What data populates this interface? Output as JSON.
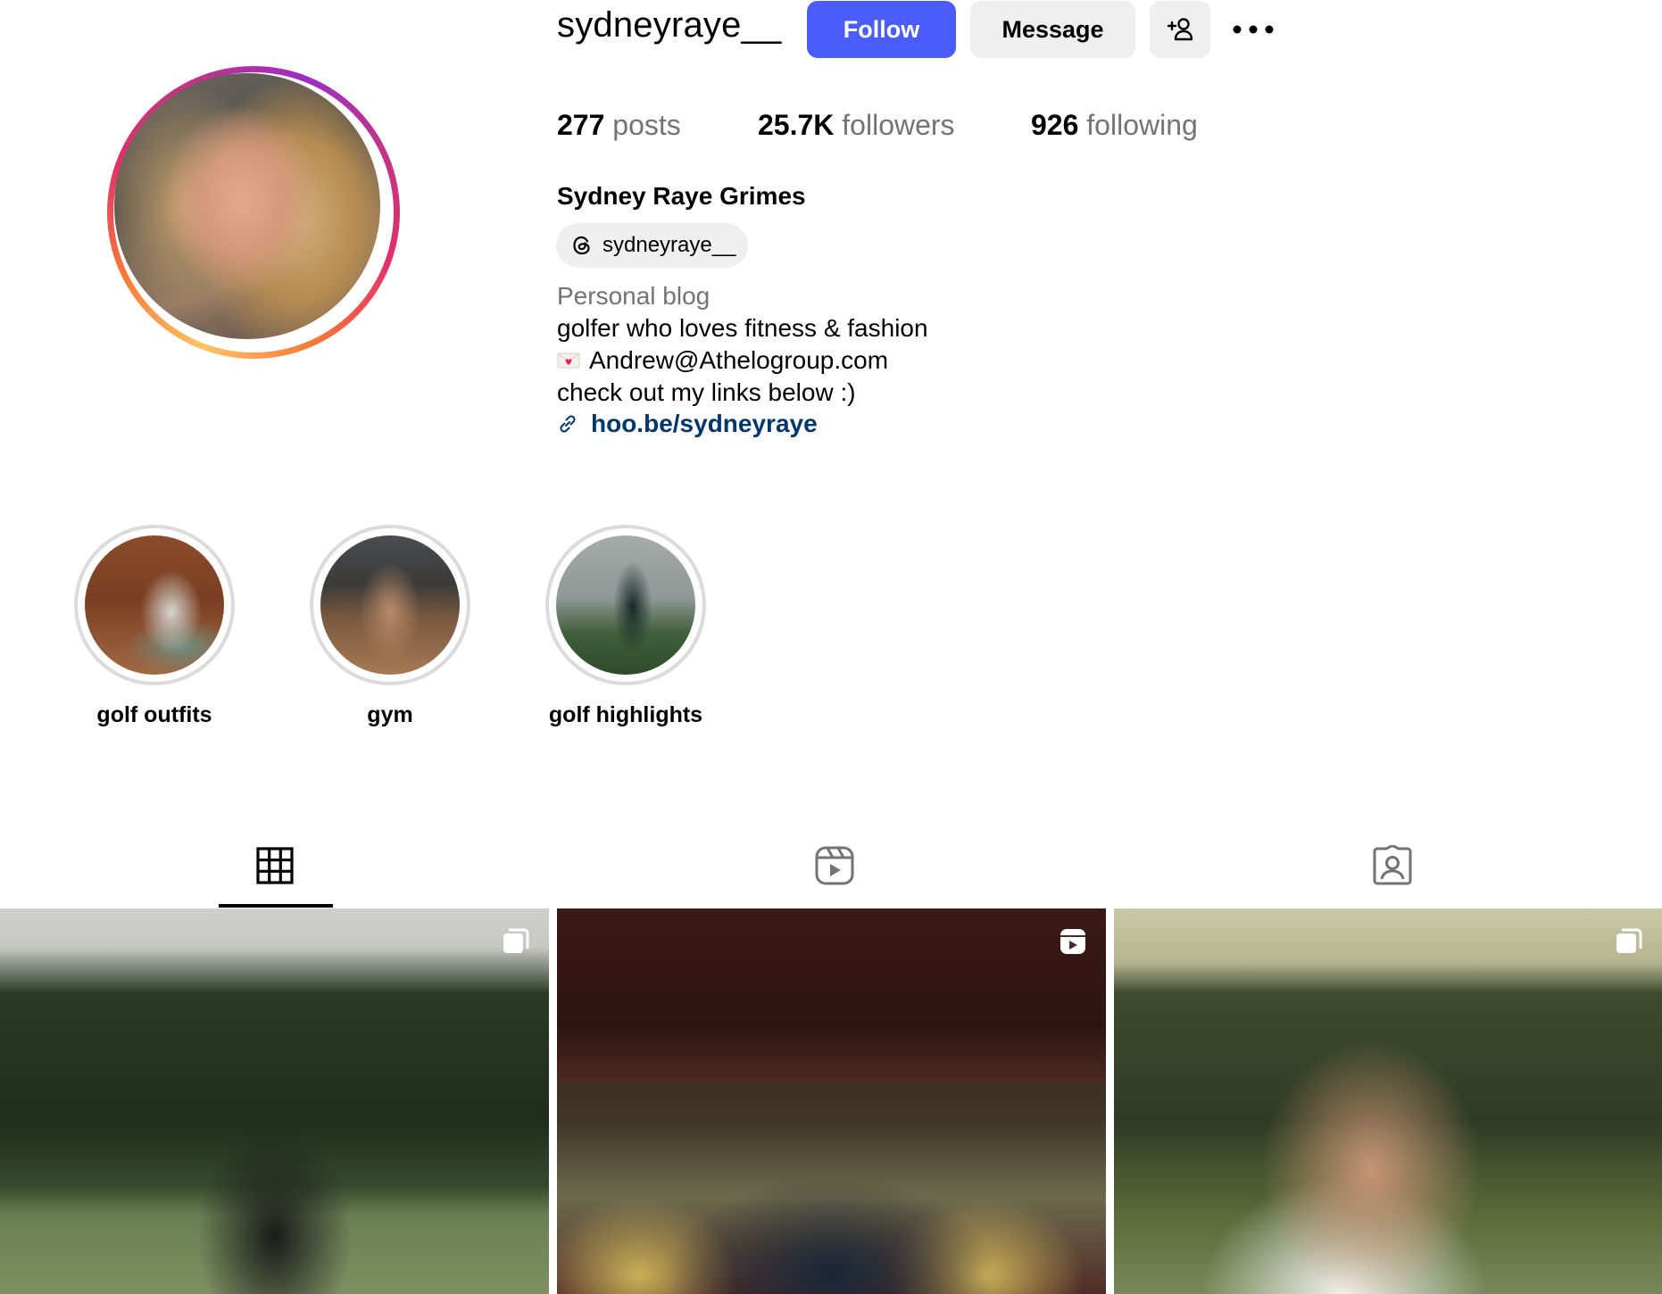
{
  "profile": {
    "username": "sydneyraye__",
    "full_name": "Sydney Raye Grimes",
    "threads_handle": "sydneyraye__",
    "category": "Personal blog",
    "bio": [
      "golfer who loves fitness & fashion",
      "Andrew@Athelogroup.com",
      "check out my links below :)"
    ],
    "link": "hoo.be/sydneyraye"
  },
  "buttons": {
    "follow": "Follow",
    "message": "Message"
  },
  "stats": {
    "posts": {
      "count": "277",
      "label": "posts"
    },
    "followers": {
      "count": "25.7K",
      "label": "followers"
    },
    "following": {
      "count": "926",
      "label": "following"
    }
  },
  "highlights": [
    {
      "label": "golf outfits"
    },
    {
      "label": "gym"
    },
    {
      "label": "golf highlights"
    }
  ],
  "tabs": [
    {
      "icon": "grid-icon",
      "active": true
    },
    {
      "icon": "reels-icon",
      "active": false
    },
    {
      "icon": "tagged-icon",
      "active": false
    }
  ],
  "grid_posts": [
    {
      "type": "carousel",
      "icon": "carousel-icon"
    },
    {
      "type": "reel",
      "icon": "reel-icon"
    },
    {
      "type": "carousel",
      "icon": "carousel-icon"
    }
  ],
  "colors": {
    "follow_button": "#4a5df9",
    "secondary_button": "#efefef",
    "link": "#00376b",
    "muted_text": "#737373"
  }
}
